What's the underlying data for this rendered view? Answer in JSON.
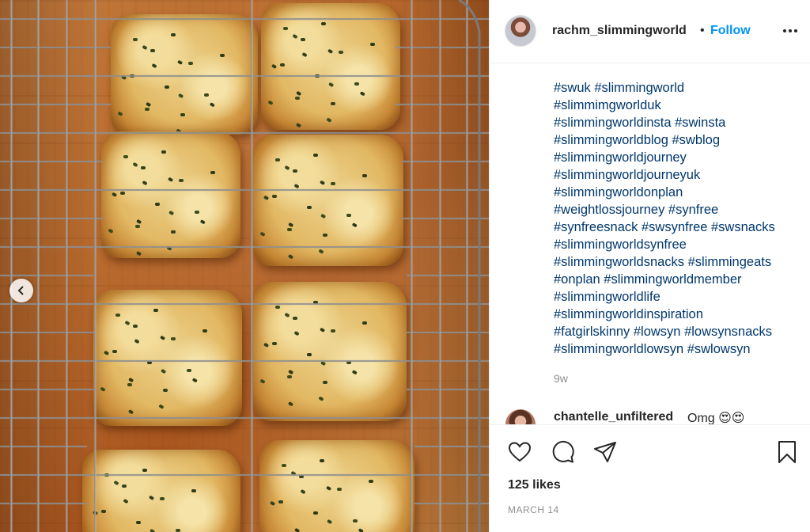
{
  "post": {
    "username": "rachm_slimmingworld",
    "separator": "•",
    "follow_label": "Follow",
    "more_icon": "more-horizontal-icon",
    "caption_lines": [
      "#swuk #slimmingworld",
      "#slimmimgworlduk",
      "#slimmingworldinsta #swinsta",
      "#slimmingworldblog #swblog",
      "#slimmingworldjourney",
      "#slimmingworldjourneyuk",
      "#slimmingworldonplan",
      "#weightlossjourney #synfree",
      "#synfreesnack #swsynfree #swsnacks",
      "#slimmingworldsynfree",
      "#slimmingworldsnacks #slimmingeats",
      "#onplan #slimmingworldmember",
      "#slimmingworldlife",
      "#slimmingworldinspiration",
      "#fatgirlskinny #lowsyn #lowsynsnacks",
      "#slimmingworldlowsyn #swlowsyn"
    ],
    "age": "9w",
    "likes": "125 likes",
    "date": "MARCH 14"
  },
  "comment": {
    "username": "chantelle_unfiltered",
    "text": "Omg 😍😍"
  },
  "actions": {
    "icons": [
      "heart-icon",
      "comment-icon",
      "share-icon",
      "bookmark-icon"
    ]
  },
  "photo": {
    "subject": "cheese and chive scones on a cooling rack",
    "prev_icon": "chevron-left-icon"
  },
  "colors": {
    "link": "#00376b",
    "follow": "#0095f6",
    "muted": "#8e8e8e",
    "text": "#262626"
  }
}
